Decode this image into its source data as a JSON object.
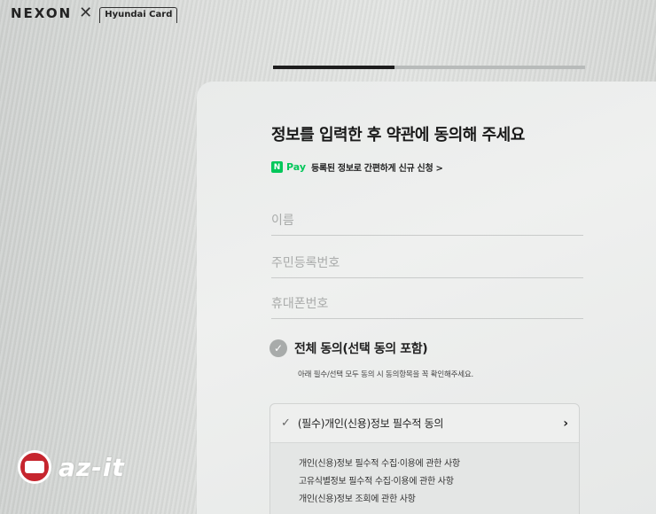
{
  "brand": {
    "nexon": "NEXON",
    "separator": "✕",
    "hyundai": "Hyundai Card"
  },
  "progress": {
    "fraction": 0.39
  },
  "title": "정보를 입력한 후 약관에 동의해 주세요",
  "npay": {
    "badge": "N",
    "word": "Pay",
    "text": "등록된 정보로 간편하게 신규 신청 >"
  },
  "fields": {
    "name": {
      "placeholder": "이름",
      "value": ""
    },
    "rrn": {
      "placeholder": "주민등록번호",
      "value": ""
    },
    "phone": {
      "placeholder": "휴대폰번호",
      "value": ""
    }
  },
  "agree_all": {
    "label": "전체 동의(선택 동의 포함)",
    "note": "아래 필수/선택 모두 동의 시 동의항목을 꼭 확인해주세요."
  },
  "terms": {
    "header": "(필수)개인(신용)정보 필수적 동의",
    "chevron": "›",
    "items": [
      "개인(신용)정보 필수적 수집·이용에 관한 사항",
      "고유식별정보 필수적 수집·이용에 관한 사항",
      "개인(신용)정보 조회에 관한 사항"
    ]
  },
  "watermark": {
    "text": "az-it"
  },
  "icons": {
    "check": "check-icon",
    "chevron": "chevron-right-icon"
  },
  "colors": {
    "npay_green": "#03c75a",
    "progress_fill": "#1d1d1d",
    "watermark_red": "#c6252e"
  }
}
